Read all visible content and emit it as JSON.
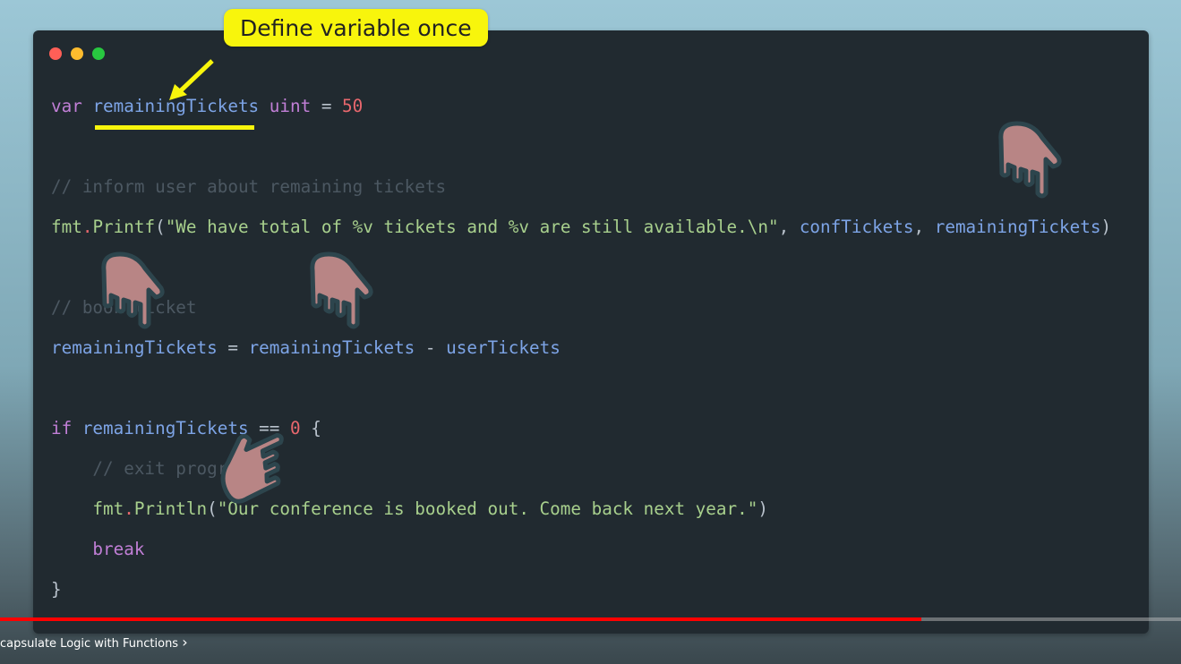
{
  "annotation": {
    "callout": "Define variable once"
  },
  "window_controls": [
    {
      "name": "close",
      "color": "#ff5f57"
    },
    {
      "name": "minimize",
      "color": "#febc2e"
    },
    {
      "name": "maximize",
      "color": "#28c840"
    }
  ],
  "code_lines": [
    {
      "row": 0,
      "indent": 0,
      "tokens": [
        {
          "t": "var",
          "c": "kw"
        },
        {
          "t": " "
        },
        {
          "t": "remainingTickets",
          "c": "var"
        },
        {
          "t": " "
        },
        {
          "t": "uint",
          "c": "kw"
        },
        {
          "t": " = ",
          "c": "pl"
        },
        {
          "t": "50",
          "c": "num"
        }
      ]
    },
    {
      "row": 2,
      "indent": 0,
      "tokens": [
        {
          "t": "// inform user about remaining tickets",
          "c": "cm"
        }
      ]
    },
    {
      "row": 3,
      "indent": 0,
      "tokens": [
        {
          "t": "fmt",
          "c": "str"
        },
        {
          "t": ".",
          "c": "num"
        },
        {
          "t": "Printf",
          "c": "str"
        },
        {
          "t": "(",
          "c": "pl"
        },
        {
          "t": "\"We have total of %v tickets and %v are still available.\\n\"",
          "c": "str"
        },
        {
          "t": ", ",
          "c": "pl"
        },
        {
          "t": "confTickets",
          "c": "var"
        },
        {
          "t": ", ",
          "c": "pl"
        },
        {
          "t": "remainingTickets",
          "c": "var"
        },
        {
          "t": ")",
          "c": "pl"
        }
      ]
    },
    {
      "row": 5,
      "indent": 0,
      "tokens": [
        {
          "t": "// book ticket",
          "c": "cm"
        }
      ]
    },
    {
      "row": 6,
      "indent": 0,
      "tokens": [
        {
          "t": "remainingTickets",
          "c": "var"
        },
        {
          "t": " = ",
          "c": "pl"
        },
        {
          "t": "remainingTickets",
          "c": "var"
        },
        {
          "t": " - ",
          "c": "pl"
        },
        {
          "t": "userTickets",
          "c": "var"
        }
      ]
    },
    {
      "row": 8,
      "indent": 0,
      "tokens": [
        {
          "t": "if",
          "c": "kw"
        },
        {
          "t": " "
        },
        {
          "t": "remainingTickets",
          "c": "var"
        },
        {
          "t": " == ",
          "c": "pl"
        },
        {
          "t": "0",
          "c": "num"
        },
        {
          "t": " {",
          "c": "pl"
        }
      ]
    },
    {
      "row": 9,
      "indent": 1,
      "tokens": [
        {
          "t": "// exit program",
          "c": "cm"
        }
      ]
    },
    {
      "row": 10,
      "indent": 1,
      "tokens": [
        {
          "t": "fmt",
          "c": "str"
        },
        {
          "t": ".",
          "c": "num"
        },
        {
          "t": "Println",
          "c": "str"
        },
        {
          "t": "(",
          "c": "pl"
        },
        {
          "t": "\"Our conference is booked out. Come back next year.\"",
          "c": "str"
        },
        {
          "t": ")",
          "c": "pl"
        }
      ]
    },
    {
      "row": 11,
      "indent": 1,
      "tokens": [
        {
          "t": "break",
          "c": "kw"
        }
      ]
    },
    {
      "row": 12,
      "indent": 0,
      "tokens": [
        {
          "t": "}",
          "c": "pl"
        }
      ]
    }
  ],
  "player": {
    "progress_percent": 78,
    "chapter_title": "capsulate Logic with Functions",
    "chapter_chevron": "›"
  },
  "colors": {
    "callout": "#f8f50c",
    "hand": "#b88585",
    "progress": "#ff0000"
  }
}
